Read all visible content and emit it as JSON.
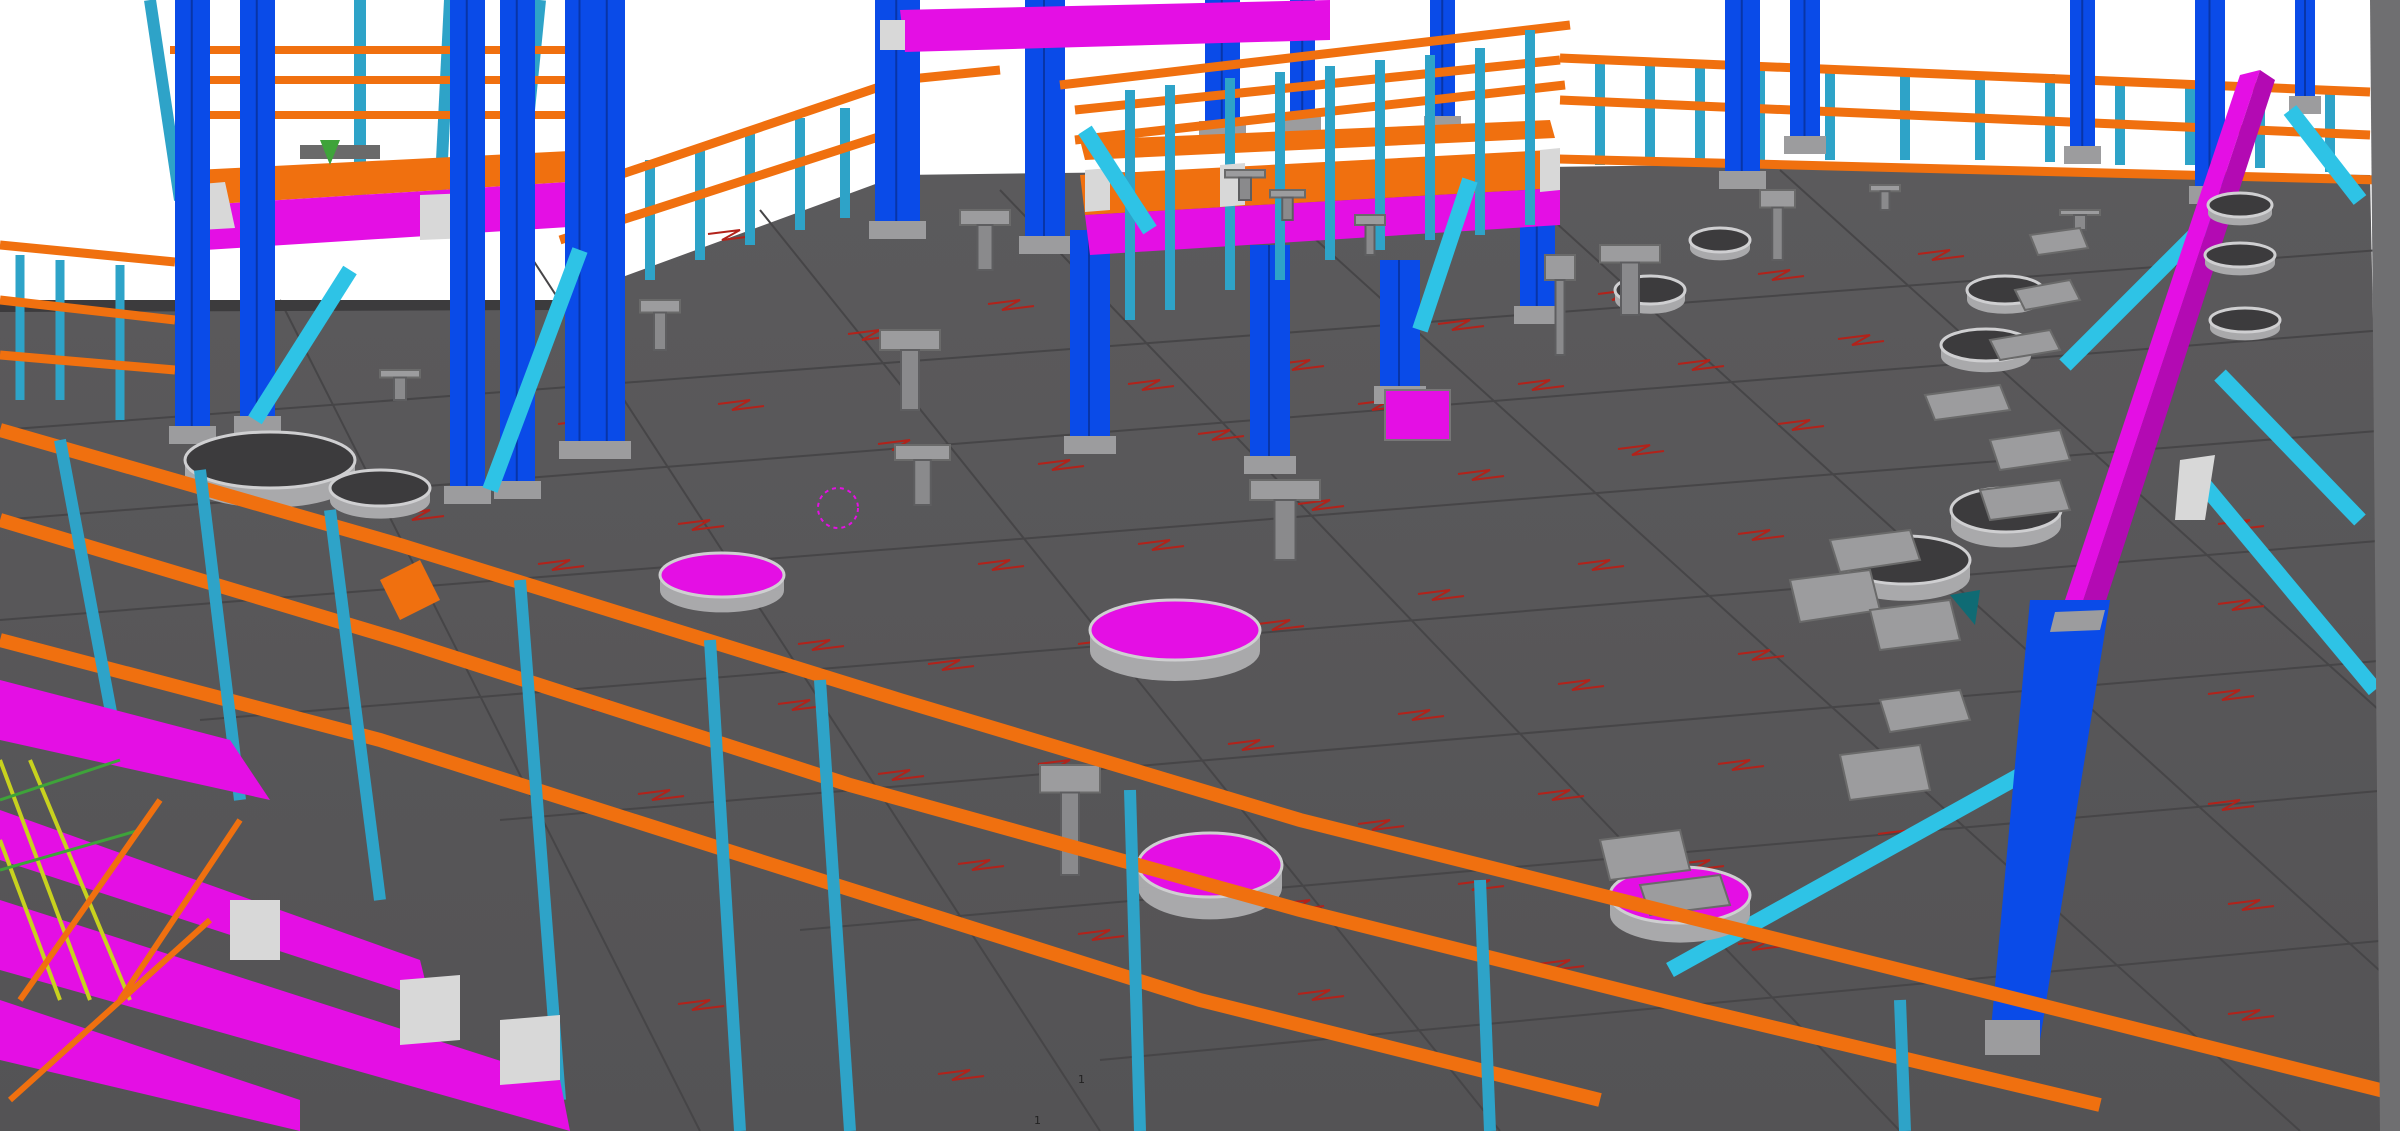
{
  "view": {
    "label": "3D model view",
    "colors": {
      "sky": "#ffffff",
      "deck_plate": "#5a595b",
      "deck_seam": "#474648",
      "column_primary": "#0a4be8",
      "column_secondary": "#2ea3c8",
      "handrail": "#f0700f",
      "beam": "#e40fe4",
      "bracing": "#2ec3e6",
      "opening": "#a9a9ab",
      "fitting_grey": "#9c9c9e",
      "plate_mark": "#b2221a",
      "connection_plate": "#d8d8d8",
      "lower_structure_yellow": "#c8d21e",
      "lower_structure_green": "#3ea33a"
    }
  },
  "labels": {
    "point_mark_a": "1",
    "point_mark_b": "1"
  }
}
